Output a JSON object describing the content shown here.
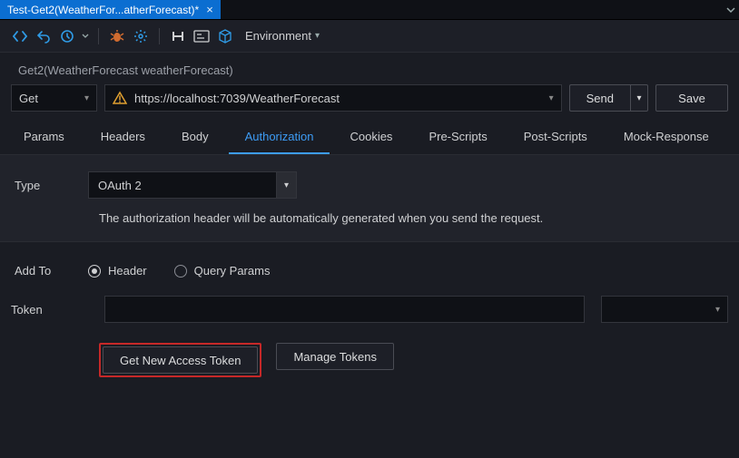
{
  "tab": {
    "title": "Test-Get2(WeatherFor...atherForecast)*"
  },
  "toolbar": {
    "environment_label": "Environment"
  },
  "signature": "Get2(WeatherForecast weatherForecast)",
  "request": {
    "method": "Get",
    "url": "https://localhost:7039/WeatherForecast",
    "send_label": "Send",
    "save_label": "Save"
  },
  "tabs": {
    "params": "Params",
    "headers": "Headers",
    "body": "Body",
    "authorization": "Authorization",
    "cookies": "Cookies",
    "prescripts": "Pre-Scripts",
    "postscripts": "Post-Scripts",
    "mockresponse": "Mock-Response",
    "active": "authorization"
  },
  "auth": {
    "type_label": "Type",
    "type_value": "OAuth 2",
    "hint": "The authorization header will be automatically generated when you send the request.",
    "addto_label": "Add To",
    "addto_options": {
      "header": "Header",
      "query": "Query Params"
    },
    "addto_selected": "header",
    "token_label": "Token",
    "token_value": "",
    "get_token_label": "Get New Access Token",
    "manage_label": "Manage Tokens"
  },
  "colors": {
    "accent": "#0b6ed1",
    "highlight": "#c62828",
    "link": "#3d9cf5"
  }
}
